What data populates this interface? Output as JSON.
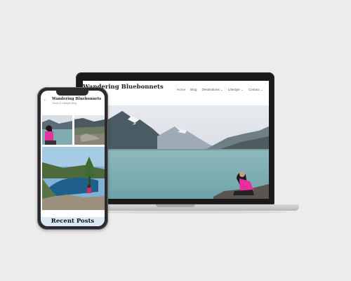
{
  "laptop": {
    "site_title": "Wandering Bluebonnets",
    "nav": [
      "Home",
      "Blog",
      "Destinations ⌄",
      "Lifestyle ⌄",
      "Contact ⌄"
    ]
  },
  "phone": {
    "site_title": "Wandering Bluebonnets",
    "tagline": "Travel & Lifestyle Blog",
    "section_heading": "Recent Posts"
  },
  "colors": {
    "background": "#ececec",
    "device_frame": "#1a1a1b",
    "nav_active": "#2f7fc1",
    "recent_band": "#dce9f5"
  }
}
